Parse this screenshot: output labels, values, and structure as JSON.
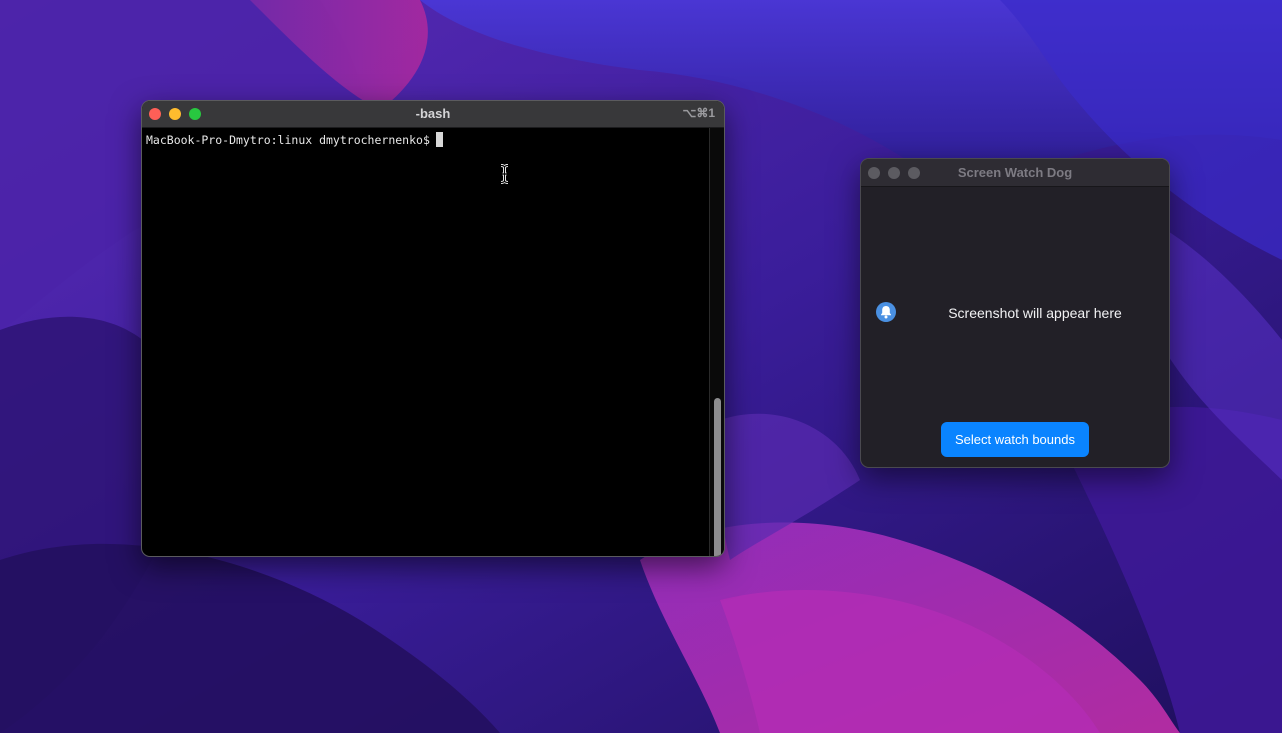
{
  "terminal": {
    "title": "-bash",
    "shortcut": "⌥⌘1",
    "prompt": "MacBook-Pro-Dmytro:linux dmytrochernenko$"
  },
  "screen_watch_dog": {
    "title": "Screen Watch Dog",
    "placeholder": "Screenshot will appear here",
    "select_button_label": "Select watch bounds"
  },
  "colors": {
    "accent_button": "#0a84ff",
    "terminal_background": "#000000",
    "window_close": "#fe5f57",
    "window_minimize": "#febc2e",
    "window_zoom": "#28c840"
  },
  "icons": {
    "terminal_cursor": "i-beam-cursor-icon",
    "placeholder_icon": "bell-icon"
  }
}
